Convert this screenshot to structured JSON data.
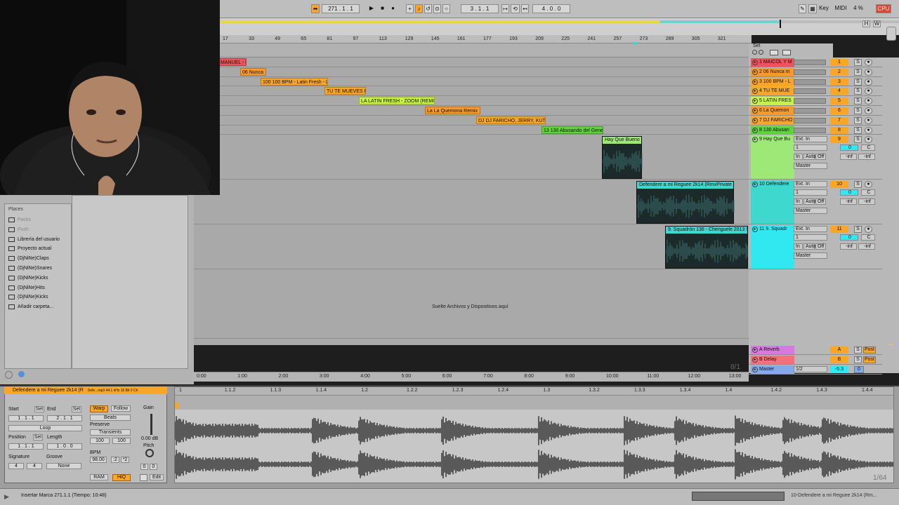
{
  "transport": {
    "position": "271 .  1 .  1",
    "loop_start": "3 .  1 .  1",
    "loop_length": "4 .  0 .  0",
    "key_label": "Key",
    "midi_label": "MIDI",
    "cpu_value": "4 %",
    "cpu_label": "CPU",
    "h_label": "H",
    "w_label": "W"
  },
  "ruler": {
    "bars": [
      "17",
      "33",
      "49",
      "65",
      "81",
      "97",
      "113",
      "129",
      "145",
      "161",
      "177",
      "193",
      "209",
      "225",
      "241",
      "257",
      "273",
      "289",
      "305",
      "321"
    ],
    "set_label": "Set"
  },
  "clips": [
    {
      "label": "MANUEL - M",
      "color": "#f2505a"
    },
    {
      "label": "06 Nunca",
      "color": "#f79a2c"
    },
    {
      "label": "100 100 BPM - Latin Fresh - L",
      "color": "#f7a62a"
    },
    {
      "label": "TU TE MUEVES  B",
      "color": "#f7a62a"
    },
    {
      "label": "LA LATIN FRESH - ZOOM (REMIX",
      "color": "#c6f24a"
    },
    {
      "label": "La La Quemona Remix",
      "color": "#f79a2c"
    },
    {
      "label": "DJ DJ FARICHO, JERRY, KUTT",
      "color": "#f7a62a"
    },
    {
      "label": "13 130 Abusando del Gene",
      "color": "#5fd33d"
    }
  ],
  "audio_clips": [
    {
      "label": "Hay Que Bueno -",
      "color": "#9ee877"
    },
    {
      "label": "Defendere a mi Reguee 2k14 (RmxPrivate",
      "color": "#3fd8cf"
    },
    {
      "label": "9. Squadrón 138 - Chenguele 2013 S",
      "color": "#3fd8cf"
    }
  ],
  "drop_text": "Suelte Archivos y Dispositivos aquí",
  "tracks": [
    {
      "name": "1 MAICOL Y M",
      "num": "1",
      "color": "#f2505a"
    },
    {
      "name": "2 06 Nunca m",
      "num": "2",
      "color": "#f79a2c"
    },
    {
      "name": "3 100 BPM - L",
      "num": "3",
      "color": "#f7a62a"
    },
    {
      "name": "4 TU TE MUE",
      "num": "4",
      "color": "#f7a62a"
    },
    {
      "name": "5 LATIN FRES",
      "num": "5",
      "color": "#c6f24a"
    },
    {
      "name": "6 La Quemon",
      "num": "6",
      "color": "#f79a2c"
    },
    {
      "name": "7 DJ FARICHO",
      "num": "7",
      "color": "#f7a62a"
    },
    {
      "name": "8 130 Abusan",
      "num": "8",
      "color": "#5fd33d"
    },
    {
      "name": "9 Hay Que Bu",
      "num": "9",
      "color": "#9ee877"
    },
    {
      "name": "10 Defendere",
      "num": "10",
      "color": "#3fd8cf"
    },
    {
      "name": "11 9. Squadr",
      "num": "11",
      "color": "#32e8f0"
    }
  ],
  "track_io": {
    "input": "Ext. In",
    "channel": "1",
    "monitor_in": "In",
    "monitor_auto": "Auto",
    "monitor_off": "Off",
    "output": "Master",
    "send_a": "0",
    "send_c": "C",
    "inf": "-inf"
  },
  "returns": [
    {
      "name": "A Reverb",
      "letter": "A",
      "color": "#d879e0"
    },
    {
      "name": "B Delay",
      "letter": "B",
      "color": "#f56f7e"
    },
    {
      "name": "Master",
      "letter": "0",
      "color": "#86a9e8"
    }
  ],
  "master": {
    "ratio": "1/2",
    "volume": "-5.3",
    "post": "Post"
  },
  "zoom_ratio": "8/1",
  "time_ruler": [
    "0:00",
    "1:00",
    "2:00",
    "3:00",
    "4:00",
    "5:00",
    "6:00",
    "7:00",
    "8:00",
    "9:00",
    "10:00",
    "11:00",
    "12:00",
    "13:00"
  ],
  "browser": {
    "header": "Places",
    "items": [
      "Packs",
      "Push",
      "Librería del usuario",
      "Proyecto actual",
      "(DjNiNe)Claps",
      "(DjNiNe)Snares",
      "(DjNiNe)Kicks",
      "(DjNiNe)Hits",
      "(DjNiNe)Kicks",
      "Añadir carpeta..."
    ]
  },
  "clip_detail": {
    "title": "Defendere a mi Reguee 2k14 (R",
    "meta": "Defe...mp3  44.1 kHz  16 Bit  2 Ch",
    "start": "Start",
    "end": "End",
    "set": "Set",
    "start_val": "1 .  1 .  1",
    "end_val": "2 .  1 .  1",
    "loop": "Loop",
    "position": "Position",
    "length": "Length",
    "position_val": "1 .  1 .  1",
    "length_val": "1 .  0 .  0",
    "signature": "Signature",
    "sig_num": "4",
    "sig_den": "4",
    "groove": "Groove",
    "groove_val": "None",
    "warp": "Warp",
    "follow": "Follow",
    "beats": "Beats",
    "preserve": "Preserve",
    "transients": "Transients",
    "amount": "100",
    "bpm": "BPM",
    "bpm_val": "98.00",
    "half": ":2",
    "double": "*2",
    "gain": "Gain",
    "gain_val": "0.00 dB",
    "pitch": "Pitch",
    "pitch_a": "0",
    "pitch_b": "0",
    "ram": "RAM",
    "hiq": "HiQ",
    "edit": "Edit",
    "zoom": "1/64"
  },
  "wave_ruler": [
    "1",
    "1.1.2",
    "1.1.3",
    "1.1.4",
    "1.2",
    "1.2.2",
    "1.2.3",
    "1.2.4",
    "1.3",
    "1.3.2",
    "1.3.3",
    "1.3.4",
    "1.4",
    "1.4.2",
    "1.4.3",
    "1.4.4"
  ],
  "status": {
    "message": "Insertar Marca 271.1.1 (Tiempo: 10:48)",
    "track": "10-Defendere a mi Reguee 2k14 (Rm..."
  }
}
